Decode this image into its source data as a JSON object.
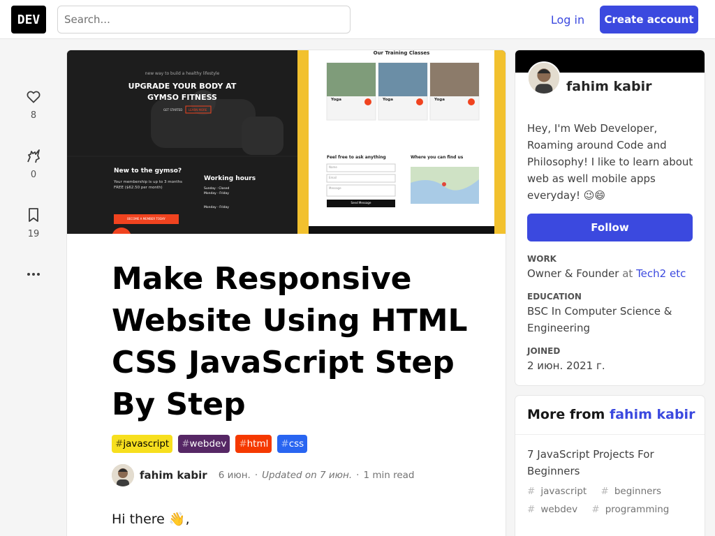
{
  "header": {
    "logo_text": "DEV",
    "search_placeholder": "Search...",
    "login_label": "Log in",
    "create_account_label": "Create account"
  },
  "reactions": {
    "likes": "8",
    "unicorns": "0",
    "saves": "19"
  },
  "cover": {
    "tagline": "new way to build a healthy lifestyle",
    "hero_line1": "UPGRADE YOUR BODY AT",
    "hero_line2": "GYMSO FITNESS",
    "btn_get_started": "GET STARTED",
    "btn_learn_more": "LEARN MORE",
    "new_heading": "New to the gymso?",
    "new_text1": "Your membership is up to 3 months",
    "new_text2": "FREE ($62.50 per month)",
    "new_cta": "BECOME A MEMBER TODAY",
    "hours_heading": "Working hours",
    "hours_1": "Sunday : Closed",
    "hours_2": "Monday - Friday",
    "hours_3": "Monday - Friday",
    "classes_heading": "Our Training Classes",
    "class_name": "Yoga",
    "contact_heading": "Feel free to ask anything",
    "field_name": "Name",
    "field_email": "Email",
    "field_message": "Message",
    "send_label": "Send Message",
    "where_heading": "Where you can find us"
  },
  "article": {
    "title": "Make Responsive Website Using HTML CSS JavaScript Step By Step",
    "tags": [
      {
        "name": "javascript",
        "bg": "#f7df1e",
        "fg": "#000000"
      },
      {
        "name": "webdev",
        "bg": "#562765",
        "fg": "#ffffff"
      },
      {
        "name": "html",
        "bg": "#f53900",
        "fg": "#ffffff"
      },
      {
        "name": "css",
        "bg": "#2965f1",
        "fg": "#ffffff"
      }
    ],
    "author": "fahim kabir",
    "date": "6 июн.",
    "updated": "Updated on 7 июн.",
    "read_time": "1 min read",
    "intro": "Hi there 👋,"
  },
  "profile": {
    "name": "fahim kabir",
    "bio": "Hey, I'm Web Developer, Roaming around Code and Philosophy! I like to learn about web as well mobile apps everyday! 😉😄",
    "follow_label": "Follow",
    "work_label": "WORK",
    "work_role": "Owner & Founder",
    "work_at": "at",
    "work_company": "Tech2 etc",
    "education_label": "EDUCATION",
    "education_value": "BSC In Computer Science & Engineering",
    "joined_label": "JOINED",
    "joined_value": "2 июн. 2021 г."
  },
  "more_from": {
    "prefix": "More from",
    "author": "fahim kabir",
    "post_title": "7 JavaScript Projects For Beginners",
    "post_tags": [
      "javascript",
      "beginners",
      "webdev",
      "programming"
    ]
  },
  "colors": {
    "accent": "#3b49df",
    "gym_yellow": "#f2c12e",
    "gym_red": "#f0431f"
  }
}
